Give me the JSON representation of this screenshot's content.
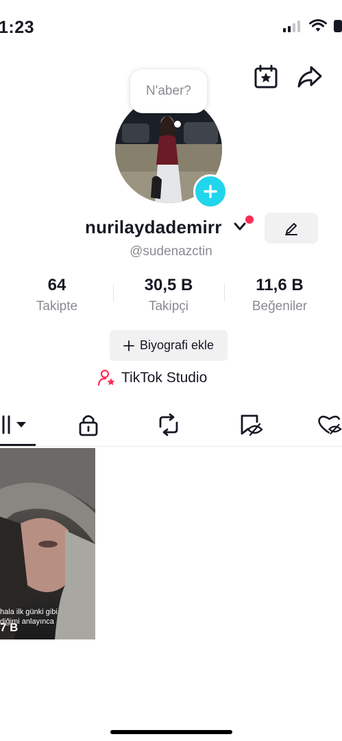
{
  "status": {
    "time": "1:23"
  },
  "note": {
    "text": "N'aber?"
  },
  "profile": {
    "username": "nurilaydademirr",
    "handle": "@sudenazctin"
  },
  "stats": [
    {
      "value": "64",
      "label": "Takipte"
    },
    {
      "value": "30,5 B",
      "label": "Takipçi"
    },
    {
      "value": "11,6 B",
      "label": "Beğeniler"
    }
  ],
  "bio_button": {
    "label": "Biyografi ekle"
  },
  "studio": {
    "label": "TikTok Studio"
  },
  "videos": [
    {
      "caption_line1": "hala ilk günki gibi",
      "caption_line2": "diğimi anlayınca",
      "views": "7 B"
    }
  ],
  "colors": {
    "accent_red": "#fe2c55",
    "accent_cyan": "#20d5ec",
    "text_secondary": "#8a8b91"
  }
}
